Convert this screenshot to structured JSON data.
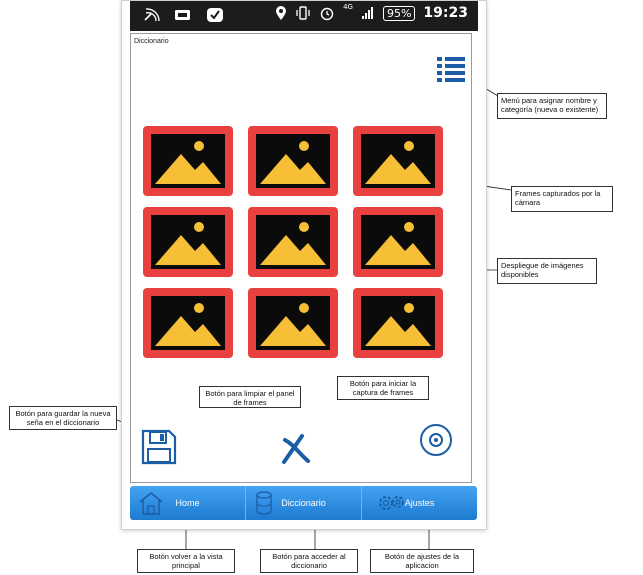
{
  "status_bar": {
    "battery": "95%",
    "time": "19:23",
    "network": "4G"
  },
  "app": {
    "title": "Diccionario",
    "menu_icon": "list-menu-icon",
    "frame_icon": "image-placeholder-icon",
    "frames_count": 9,
    "save_icon": "floppy-disk-icon",
    "clear_icon": "x-icon",
    "capture_icon": "record-target-icon"
  },
  "nav": {
    "home": "Home",
    "diccionario": "Diccionario",
    "ajustes": "Ajustes"
  },
  "callouts": {
    "menu": "Menú para asignar nombre y categoría (nueva o existente)",
    "frames": "Frames capturados por la cámara",
    "despliegue": "Despliegue de imágenes disponibles",
    "capture": "Botón para iniciar la captura de frames",
    "clear": "Botón para limpiar el panel de frames",
    "save": "Botón para guardar la nueva seña en el diccionario",
    "home": "Botón volver a la vista principal",
    "diccionario": "Botón para acceder al diccionario",
    "ajustes": "Botón de ajustes de la aplicacion"
  },
  "colors": {
    "frame_border": "#e8413f",
    "frame_bg": "#0b0b0b",
    "mountain": "#f7bf35",
    "accent": "#1b5da6",
    "nav": "#2b8ae0"
  }
}
